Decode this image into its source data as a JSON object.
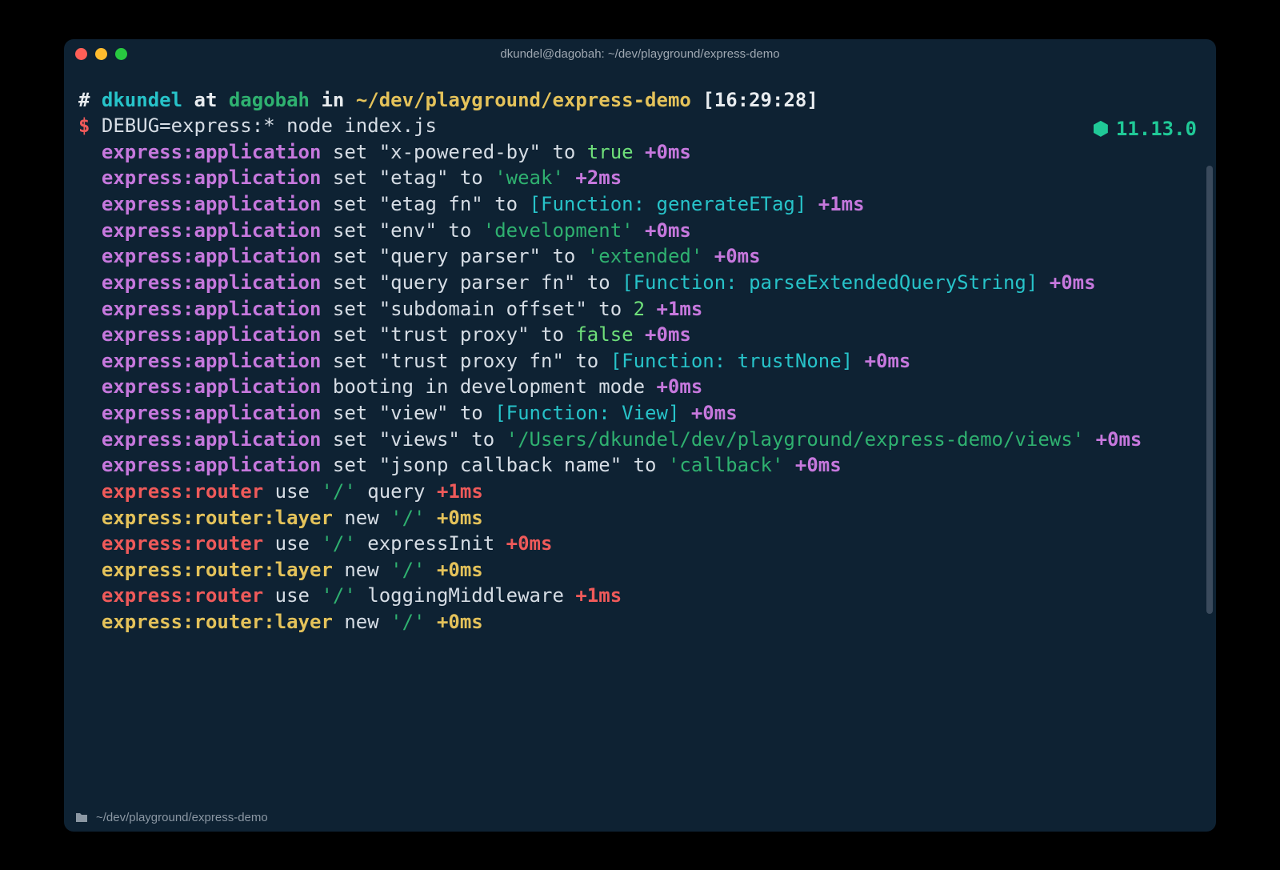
{
  "window": {
    "title": "dkundel@dagobah: ~/dev/playground/express-demo"
  },
  "node_version": "11.13.0",
  "statusbar": {
    "path": "~/dev/playground/express-demo"
  },
  "prompt": {
    "hash": "#",
    "user": "dkundel",
    "at": " at ",
    "host": "dagobah",
    "in": " in ",
    "cwd": "~/dev/playground/express-demo",
    "time": " [16:29:28]",
    "dollar": "$",
    "command": " DEBUG=express:* node index.js"
  },
  "lines": [
    {
      "ns": "express:application",
      "nsClass": "fg-ns-app",
      "segs": [
        {
          "t": " set ",
          "c": "fg-gray"
        },
        {
          "t": "\"x-powered-by\"",
          "c": "fg-gray"
        },
        {
          "t": " to ",
          "c": "fg-gray"
        },
        {
          "t": "true",
          "c": "fg-green-l"
        },
        {
          "t": " ",
          "c": ""
        },
        {
          "t": "+0ms",
          "c": "fg-ns-app"
        }
      ]
    },
    {
      "ns": "express:application",
      "nsClass": "fg-ns-app",
      "segs": [
        {
          "t": " set ",
          "c": "fg-gray"
        },
        {
          "t": "\"etag\"",
          "c": "fg-gray"
        },
        {
          "t": " to ",
          "c": "fg-gray"
        },
        {
          "t": "'weak'",
          "c": "fg-green"
        },
        {
          "t": " ",
          "c": ""
        },
        {
          "t": "+2ms",
          "c": "fg-ns-app"
        }
      ]
    },
    {
      "ns": "express:application",
      "nsClass": "fg-ns-app",
      "segs": [
        {
          "t": " set ",
          "c": "fg-gray"
        },
        {
          "t": "\"etag fn\"",
          "c": "fg-gray"
        },
        {
          "t": " to ",
          "c": "fg-gray"
        },
        {
          "t": "[Function: generateETag]",
          "c": "fg-cyan"
        },
        {
          "t": " ",
          "c": ""
        },
        {
          "t": "+1ms",
          "c": "fg-ns-app"
        }
      ]
    },
    {
      "ns": "express:application",
      "nsClass": "fg-ns-app",
      "segs": [
        {
          "t": " set ",
          "c": "fg-gray"
        },
        {
          "t": "\"env\"",
          "c": "fg-gray"
        },
        {
          "t": " to ",
          "c": "fg-gray"
        },
        {
          "t": "'development'",
          "c": "fg-green"
        },
        {
          "t": " ",
          "c": ""
        },
        {
          "t": "+0ms",
          "c": "fg-ns-app"
        }
      ]
    },
    {
      "ns": "express:application",
      "nsClass": "fg-ns-app",
      "segs": [
        {
          "t": " set ",
          "c": "fg-gray"
        },
        {
          "t": "\"query parser\"",
          "c": "fg-gray"
        },
        {
          "t": " to ",
          "c": "fg-gray"
        },
        {
          "t": "'extended'",
          "c": "fg-green"
        },
        {
          "t": " ",
          "c": ""
        },
        {
          "t": "+0ms",
          "c": "fg-ns-app"
        }
      ]
    },
    {
      "ns": "express:application",
      "nsClass": "fg-ns-app",
      "segs": [
        {
          "t": " set ",
          "c": "fg-gray"
        },
        {
          "t": "\"query parser fn\"",
          "c": "fg-gray"
        },
        {
          "t": " to ",
          "c": "fg-gray"
        },
        {
          "t": "[Function: parseExtendedQueryString]",
          "c": "fg-cyan"
        },
        {
          "t": " ",
          "c": ""
        },
        {
          "t": "+0ms",
          "c": "fg-ns-app"
        }
      ]
    },
    {
      "ns": "express:application",
      "nsClass": "fg-ns-app",
      "segs": [
        {
          "t": " set ",
          "c": "fg-gray"
        },
        {
          "t": "\"subdomain offset\"",
          "c": "fg-gray"
        },
        {
          "t": " to ",
          "c": "fg-gray"
        },
        {
          "t": "2",
          "c": "fg-green-l"
        },
        {
          "t": " ",
          "c": ""
        },
        {
          "t": "+1ms",
          "c": "fg-ns-app"
        }
      ]
    },
    {
      "ns": "express:application",
      "nsClass": "fg-ns-app",
      "segs": [
        {
          "t": " set ",
          "c": "fg-gray"
        },
        {
          "t": "\"trust proxy\"",
          "c": "fg-gray"
        },
        {
          "t": " to ",
          "c": "fg-gray"
        },
        {
          "t": "false",
          "c": "fg-green-l"
        },
        {
          "t": " ",
          "c": ""
        },
        {
          "t": "+0ms",
          "c": "fg-ns-app"
        }
      ]
    },
    {
      "ns": "express:application",
      "nsClass": "fg-ns-app",
      "segs": [
        {
          "t": " set ",
          "c": "fg-gray"
        },
        {
          "t": "\"trust proxy fn\"",
          "c": "fg-gray"
        },
        {
          "t": " to ",
          "c": "fg-gray"
        },
        {
          "t": "[Function: trustNone]",
          "c": "fg-cyan"
        },
        {
          "t": " ",
          "c": ""
        },
        {
          "t": "+0ms",
          "c": "fg-ns-app"
        }
      ]
    },
    {
      "ns": "express:application",
      "nsClass": "fg-ns-app",
      "segs": [
        {
          "t": " booting in development mode ",
          "c": "fg-gray"
        },
        {
          "t": "+0ms",
          "c": "fg-ns-app"
        }
      ]
    },
    {
      "ns": "express:application",
      "nsClass": "fg-ns-app",
      "segs": [
        {
          "t": " set ",
          "c": "fg-gray"
        },
        {
          "t": "\"view\"",
          "c": "fg-gray"
        },
        {
          "t": " to ",
          "c": "fg-gray"
        },
        {
          "t": "[Function: View]",
          "c": "fg-cyan"
        },
        {
          "t": " ",
          "c": ""
        },
        {
          "t": "+0ms",
          "c": "fg-ns-app"
        }
      ]
    },
    {
      "ns": "express:application",
      "nsClass": "fg-ns-app",
      "segs": [
        {
          "t": " set ",
          "c": "fg-gray"
        },
        {
          "t": "\"views\"",
          "c": "fg-gray"
        },
        {
          "t": " to ",
          "c": "fg-gray"
        },
        {
          "t": "'/Users/dkundel/dev/playground/express-demo/views'",
          "c": "fg-green"
        },
        {
          "t": " ",
          "c": ""
        },
        {
          "t": "+0ms",
          "c": "fg-ns-app"
        }
      ]
    },
    {
      "ns": "express:application",
      "nsClass": "fg-ns-app",
      "segs": [
        {
          "t": " set ",
          "c": "fg-gray"
        },
        {
          "t": "\"jsonp callback name\"",
          "c": "fg-gray"
        },
        {
          "t": " to ",
          "c": "fg-gray"
        },
        {
          "t": "'callback'",
          "c": "fg-green"
        },
        {
          "t": " ",
          "c": ""
        },
        {
          "t": "+0ms",
          "c": "fg-ns-app"
        }
      ]
    },
    {
      "ns": "express:router",
      "nsClass": "fg-ns-rtr",
      "segs": [
        {
          "t": " use ",
          "c": "fg-gray"
        },
        {
          "t": "'/'",
          "c": "fg-green"
        },
        {
          "t": " query ",
          "c": "fg-gray"
        },
        {
          "t": "+1ms",
          "c": "fg-ns-rtr"
        }
      ]
    },
    {
      "ns": "express:router:layer",
      "nsClass": "fg-ns-lyr",
      "segs": [
        {
          "t": " new ",
          "c": "fg-gray"
        },
        {
          "t": "'/'",
          "c": "fg-green"
        },
        {
          "t": " ",
          "c": ""
        },
        {
          "t": "+0ms",
          "c": "fg-ns-lyr"
        }
      ]
    },
    {
      "ns": "express:router",
      "nsClass": "fg-ns-rtr",
      "segs": [
        {
          "t": " use ",
          "c": "fg-gray"
        },
        {
          "t": "'/'",
          "c": "fg-green"
        },
        {
          "t": " expressInit ",
          "c": "fg-gray"
        },
        {
          "t": "+0ms",
          "c": "fg-ns-rtr"
        }
      ]
    },
    {
      "ns": "express:router:layer",
      "nsClass": "fg-ns-lyr",
      "segs": [
        {
          "t": " new ",
          "c": "fg-gray"
        },
        {
          "t": "'/'",
          "c": "fg-green"
        },
        {
          "t": " ",
          "c": ""
        },
        {
          "t": "+0ms",
          "c": "fg-ns-lyr"
        }
      ]
    },
    {
      "ns": "express:router",
      "nsClass": "fg-ns-rtr",
      "segs": [
        {
          "t": " use ",
          "c": "fg-gray"
        },
        {
          "t": "'/'",
          "c": "fg-green"
        },
        {
          "t": " loggingMiddleware ",
          "c": "fg-gray"
        },
        {
          "t": "+1ms",
          "c": "fg-ns-rtr"
        }
      ]
    },
    {
      "ns": "express:router:layer",
      "nsClass": "fg-ns-lyr",
      "segs": [
        {
          "t": " new ",
          "c": "fg-gray"
        },
        {
          "t": "'/'",
          "c": "fg-green"
        },
        {
          "t": " ",
          "c": ""
        },
        {
          "t": "+0ms",
          "c": "fg-ns-lyr"
        }
      ]
    }
  ]
}
